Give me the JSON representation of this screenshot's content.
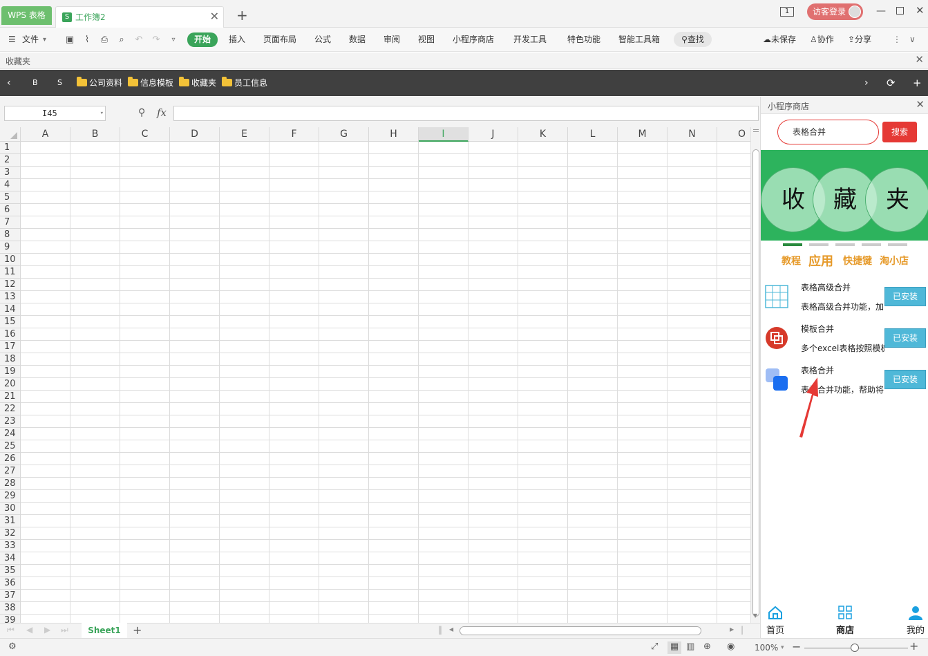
{
  "titlebar": {
    "app_tab": "WPS 表格",
    "doc_tab": "工作簿2",
    "doc_tab_icon": "S",
    "page_indicator": "1",
    "guest_login": "访客登录"
  },
  "menu": {
    "file": "文件",
    "items": [
      "开始",
      "插入",
      "页面布局",
      "公式",
      "数据",
      "审阅",
      "视图",
      "小程序商店",
      "开发工具",
      "特色功能",
      "智能工具箱"
    ],
    "find": "查找",
    "unsaved": "未保存",
    "collab": "协作",
    "share": "分享"
  },
  "favorites": {
    "title": "收藏夹",
    "b": "B",
    "s": "S",
    "folders": [
      "公司资料",
      "信息模板",
      "收藏夹",
      "员工信息"
    ]
  },
  "formula": {
    "name_box": "I45",
    "fx": "fx",
    "value": ""
  },
  "sheet": {
    "columns": [
      "A",
      "B",
      "C",
      "D",
      "E",
      "F",
      "G",
      "H",
      "I",
      "J",
      "K",
      "L",
      "M",
      "N",
      "O"
    ],
    "selected_column": "I",
    "rows": [
      "1",
      "2",
      "3",
      "4",
      "5",
      "6",
      "7",
      "8",
      "9",
      "10",
      "11",
      "12",
      "13",
      "14",
      "15",
      "16",
      "17",
      "18",
      "19",
      "20",
      "21",
      "22",
      "23",
      "24",
      "25",
      "26",
      "27",
      "28",
      "29",
      "30",
      "31",
      "32",
      "33",
      "34",
      "35",
      "36",
      "37",
      "38",
      "39"
    ],
    "tab": "Sheet1"
  },
  "status": {
    "zoom": "100%"
  },
  "panel": {
    "title": "小程序商店",
    "search_value": "表格合并",
    "search_button": "搜索",
    "banner_chars": [
      "收",
      "藏",
      "夹"
    ],
    "categories": [
      "教程",
      "应用",
      "快捷键",
      "淘小店"
    ],
    "items": [
      {
        "title": "表格高级合并",
        "desc": "表格高级合并功能，加",
        "button": "已安装"
      },
      {
        "title": "模板合并",
        "desc": "多个excel表格按照模板",
        "button": "已安装"
      },
      {
        "title": "表格合并",
        "desc": "表格合并功能，帮助将",
        "button": "已安装"
      }
    ],
    "nav": [
      "首页",
      "商店",
      "我的"
    ]
  },
  "colors": {
    "accent_green": "#3aa45a",
    "search_red": "#e53935",
    "installed_blue": "#4fb8d8",
    "category_orange": "#e69a2a",
    "arrow_red": "#e53935"
  }
}
